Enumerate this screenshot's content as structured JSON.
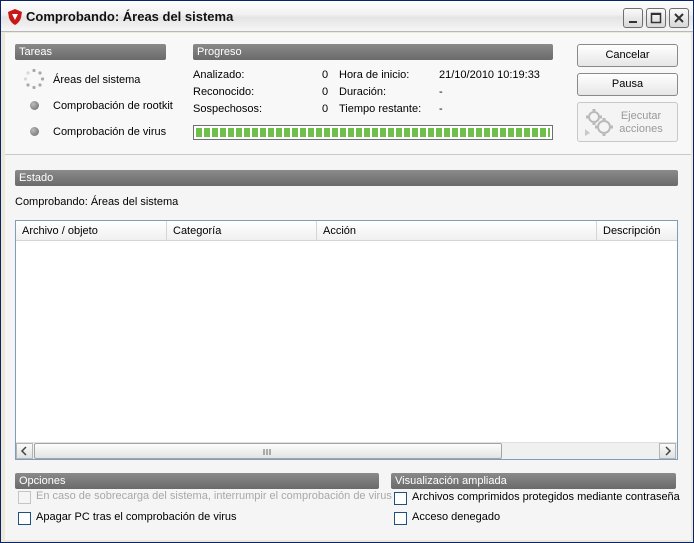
{
  "window": {
    "title": "Comprobando: Áreas del sistema",
    "accent": "#c81919"
  },
  "tasks": {
    "header": "Tareas",
    "items": [
      {
        "label": "Áreas del sistema",
        "state": "running"
      },
      {
        "label": "Comprobación de rootkit",
        "state": "pending"
      },
      {
        "label": "Comprobación de virus",
        "state": "pending"
      }
    ]
  },
  "progress": {
    "header": "Progreso",
    "analizado_label": "Analizado:",
    "analizado_value": "0",
    "reconocido_label": "Reconocido:",
    "reconocido_value": "0",
    "sospechosos_label": "Sospechosos:",
    "sospechosos_value": "0",
    "hora_label": "Hora de inicio:",
    "hora_value": "21/10/2010 10:19:33",
    "duracion_label": "Duración:",
    "duracion_value": "-",
    "restante_label": "Tiempo restante:",
    "restante_value": "-",
    "bar_fraction": 1.0,
    "bar_color": "#6ec04a"
  },
  "buttons": {
    "cancel": "Cancelar",
    "pause": "Pausa",
    "execute_line1": "Ejecutar",
    "execute_line2": "acciones"
  },
  "status": {
    "header": "Estado",
    "text": "Comprobando: Áreas del sistema"
  },
  "table": {
    "columns": [
      "Archivo / objeto",
      "Categoría",
      "Acción",
      "Descripción"
    ],
    "rows": []
  },
  "options": {
    "header": "Opciones",
    "items": [
      {
        "label": "En caso de sobrecarga del sistema, interrumpir el comprobación de virus",
        "checked": false,
        "enabled": false
      },
      {
        "label": "Apagar PC tras el comprobación de virus",
        "checked": false,
        "enabled": true
      }
    ]
  },
  "extended": {
    "header": "Visualización ampliada",
    "items": [
      {
        "label": "Archivos comprimidos protegidos mediante contraseña",
        "checked": false
      },
      {
        "label": "Acceso denegado",
        "checked": false
      }
    ]
  }
}
